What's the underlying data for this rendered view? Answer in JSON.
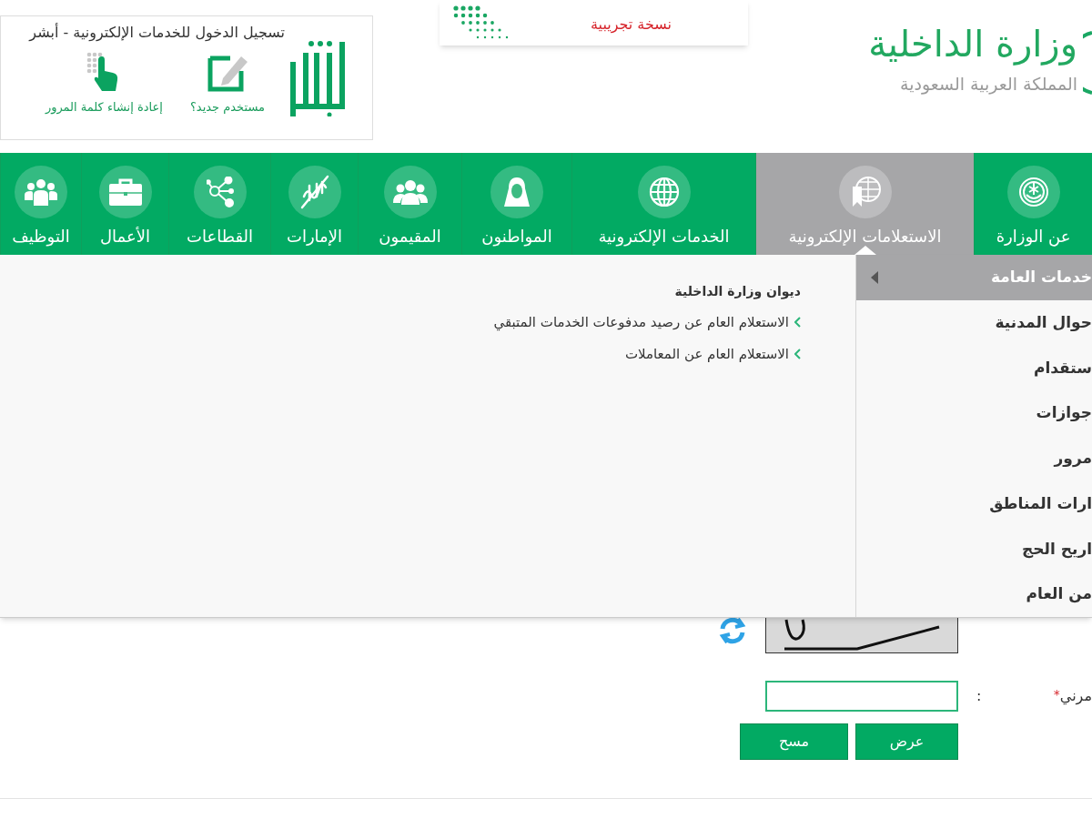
{
  "header": {
    "ministry_name": "وزارة الداخلية",
    "country": "المملكة العربية السعودية",
    "banner": {
      "note": "نسخة تجريبية"
    },
    "login_box": {
      "title": "تسجيل الدخول للخدمات الإلكترونية - أبشر",
      "links": [
        {
          "label": "مستخدم جديد؟",
          "kind": "new-user"
        },
        {
          "label": "إعادة إنشاء كلمة المرور",
          "kind": "reset-password"
        }
      ]
    }
  },
  "nav": [
    {
      "label": "عن الوزارة",
      "kind": "emblem",
      "selected": false
    },
    {
      "label": "الاستعلامات الإلكترونية",
      "kind": "query",
      "selected": true
    },
    {
      "label": "الخدمات الإلكترونية",
      "kind": "globe",
      "selected": false
    },
    {
      "label": "المواطنون",
      "kind": "citizen",
      "selected": false
    },
    {
      "label": "المقيمون",
      "kind": "group",
      "selected": false
    },
    {
      "label": "الإمارات",
      "kind": "calligraphy",
      "selected": false
    },
    {
      "label": "القطاعات",
      "kind": "nodes",
      "selected": false
    },
    {
      "label": "الأعمال",
      "kind": "briefcase",
      "selected": false
    },
    {
      "label": "التوظيف",
      "kind": "team",
      "selected": false
    }
  ],
  "dropdown": {
    "categories": [
      {
        "label": "خدمات العامة",
        "selected": true
      },
      {
        "label": "حوال المدنية",
        "selected": false
      },
      {
        "label": "ستقدام",
        "selected": false
      },
      {
        "label": "جوازات",
        "selected": false
      },
      {
        "label": "مرور",
        "selected": false
      },
      {
        "label": "ارات المناطق",
        "selected": false
      },
      {
        "label": "اريح الحج",
        "selected": false
      },
      {
        "label": "من العام",
        "selected": false
      }
    ],
    "section_title": "ديوان وزارة الداخلية",
    "links": [
      "الاستعلام العام عن رصيد مدفوعات الخدمات المتبقي",
      "الاستعلام العام عن المعاملات"
    ]
  },
  "form": {
    "field": {
      "label": "مرني",
      "required_mark": "*",
      "separator": ":"
    },
    "buttons": [
      "عرض",
      "مسح"
    ]
  }
}
